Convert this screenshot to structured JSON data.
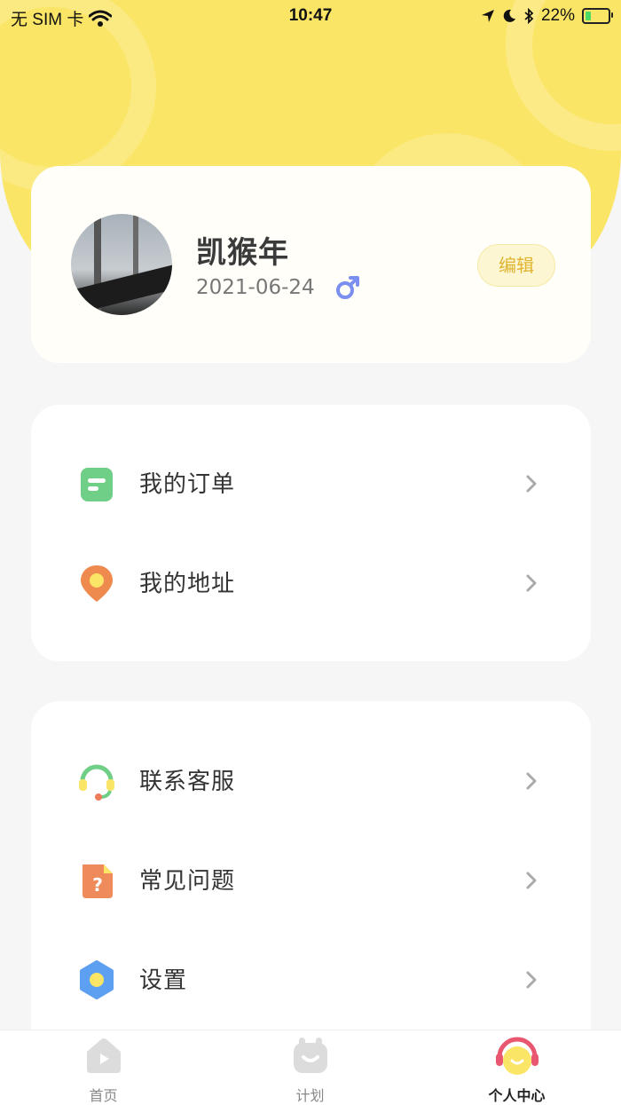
{
  "status_bar": {
    "carrier": "无 SIM 卡",
    "time": "10:47",
    "battery_percent": "22%",
    "battery_level": 0.22
  },
  "profile": {
    "name": "凯猴年",
    "date": "2021-06-24",
    "gender": "male",
    "edit_label": "编辑"
  },
  "menu_group_1": [
    {
      "label": "我的订单",
      "icon": "order-icon"
    },
    {
      "label": "我的地址",
      "icon": "location-pin-icon"
    }
  ],
  "menu_group_2": [
    {
      "label": "联系客服",
      "icon": "headset-icon"
    },
    {
      "label": "常见问题",
      "icon": "question-icon"
    },
    {
      "label": "设置",
      "icon": "settings-icon"
    }
  ],
  "tab_bar": {
    "tabs": [
      {
        "label": "首页",
        "icon": "home-icon",
        "active": false
      },
      {
        "label": "计划",
        "icon": "plan-icon",
        "active": false
      },
      {
        "label": "个人中心",
        "icon": "profile-center-icon",
        "active": true
      }
    ]
  },
  "colors": {
    "header_yellow": "#fbe566",
    "edit_text": "#e0b431",
    "gender_blue": "#7b8ff0"
  }
}
